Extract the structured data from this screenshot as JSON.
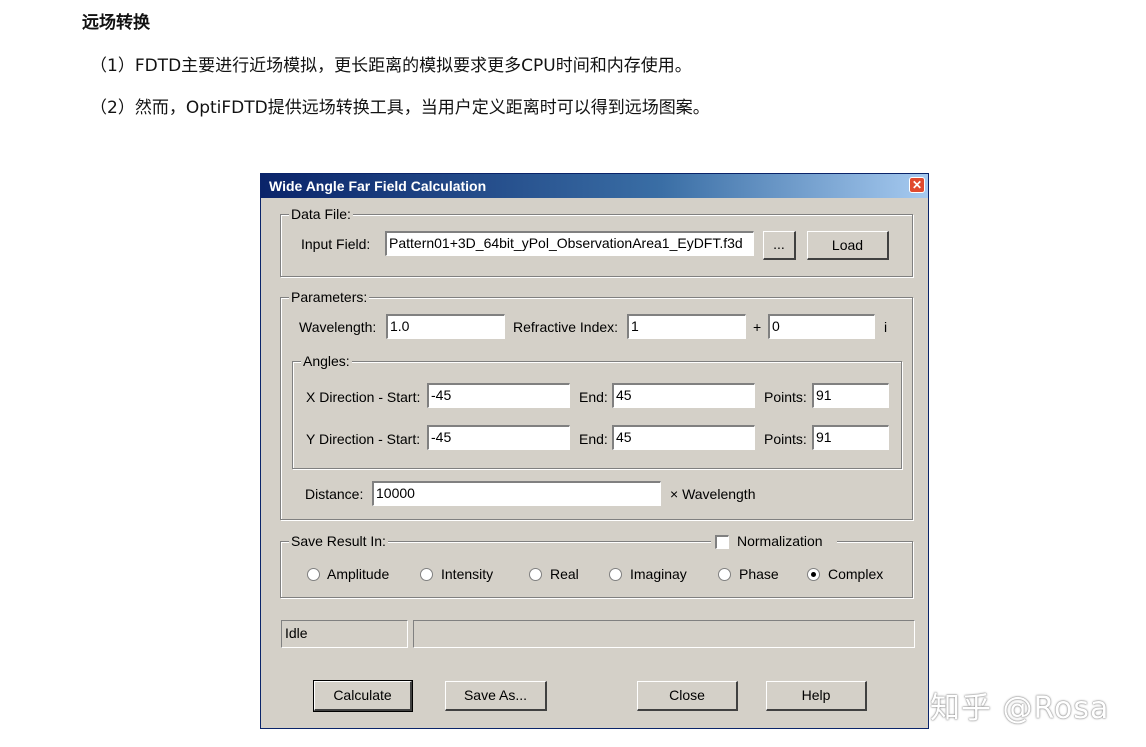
{
  "article": {
    "heading": "远场转换",
    "line1": "（1）FDTD主要进行近场模拟，更长距离的模拟要求更多CPU时间和内存使用。",
    "line2": "（2）然而，OptiFDTD提供远场转换工具，当用户定义距离时可以得到远场图案。"
  },
  "dialog": {
    "title": "Wide Angle Far Field Calculation",
    "close_glyph": "✕",
    "data_file": {
      "group_label": "Data File:",
      "input_label": "Input Field:",
      "input_value": "Pattern01+3D_64bit_yPol_ObservationArea1_EyDFT.f3d",
      "browse_label": "...",
      "load_label": "Load"
    },
    "parameters": {
      "group_label": "Parameters:",
      "wavelength_label": "Wavelength:",
      "wavelength_value": "1.0",
      "refractive_label": "Refractive Index:",
      "refractive_value": "1",
      "plus": "+",
      "imag_value": "0",
      "imag_unit": "i",
      "angles": {
        "group_label": "Angles:",
        "x_label": "X Direction - Start:",
        "x_start": "-45",
        "x_end_label": "End:",
        "x_end": "45",
        "x_points_label": "Points:",
        "x_points": "91",
        "y_label": "Y Direction - Start:",
        "y_start": "-45",
        "y_end_label": "End:",
        "y_end": "45",
        "y_points_label": "Points:",
        "y_points": "91"
      },
      "distance_label": "Distance:",
      "distance_value": "10000",
      "distance_unit": "× Wavelength"
    },
    "save_result": {
      "group_label": "Save Result In:",
      "normalization_label": "Normalization",
      "options": [
        "Amplitude",
        "Intensity",
        "Real",
        "Imaginay",
        "Phase",
        "Complex"
      ],
      "selected": "Complex"
    },
    "status": {
      "text": "Idle",
      "progress_text": ""
    },
    "buttons": {
      "calculate": "Calculate",
      "save_as": "Save As...",
      "close": "Close",
      "help": "Help"
    }
  },
  "watermark": "知乎 @Rosa"
}
